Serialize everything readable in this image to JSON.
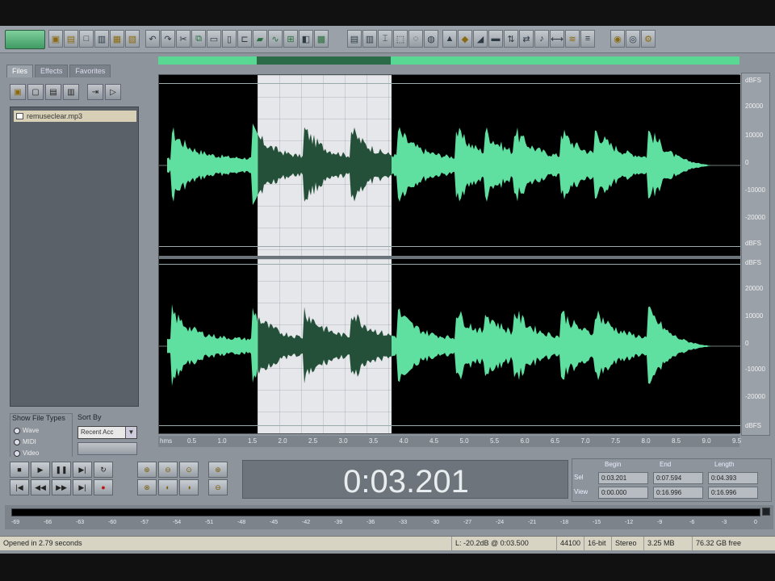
{
  "window": {
    "file_tabs": [
      "Files",
      "Effects",
      "Favorites"
    ]
  },
  "file_panel": {
    "files": [
      "remuseclear.mp3"
    ],
    "show_file_types_label": "Show File Types",
    "file_types": [
      "Wave",
      "MIDI",
      "Video"
    ],
    "sort_by_label": "Sort By",
    "sort_by_value": "Recent Acc",
    "sort_button_1": "",
    "sort_button_2": ""
  },
  "editor": {
    "db_scale_top": [
      "dBFS",
      "20000",
      "10000",
      "0",
      "-10000",
      "-20000",
      "dBFS"
    ],
    "db_scale_bottom": [
      "dBFS",
      "20000",
      "10000",
      "0",
      "-10000",
      "-20000",
      "dBFS"
    ],
    "timeline_unit": "hms",
    "timeline_ticks": [
      "0.5",
      "1.0",
      "1.5",
      "2.0",
      "2.5",
      "3.0",
      "3.5",
      "4.0",
      "4.5",
      "5.0",
      "5.5",
      "6.0",
      "6.5",
      "7.0",
      "7.5",
      "8.0",
      "8.5",
      "9.0",
      "9.5"
    ],
    "selection_fraction": [
      0.17,
      0.4
    ]
  },
  "time_display": {
    "time": "0:03.201"
  },
  "selection_view": {
    "headers": [
      "Begin",
      "End",
      "Length"
    ],
    "rows": [
      {
        "label": "Sel",
        "begin": "0:03.201",
        "end": "0:07.594",
        "length": "0:04.393"
      },
      {
        "label": "View",
        "begin": "0:00.000",
        "end": "0:16.996",
        "length": "0:16.996"
      }
    ]
  },
  "level_meter": {
    "ticks": [
      "-69",
      "-66",
      "-63",
      "-60",
      "-57",
      "-54",
      "-51",
      "-48",
      "-45",
      "-42",
      "-39",
      "-36",
      "-33",
      "-30",
      "-27",
      "-24",
      "-21",
      "-18",
      "-15",
      "-12",
      "-9",
      "-6",
      "-3",
      "0"
    ]
  },
  "status_bar": {
    "message": "Opened in 2.79 seconds",
    "level_info": "L: -20.2dB @ 0:03.500",
    "format_rate": "44100",
    "format_bits": "16-bit",
    "format_channels": "Stereo",
    "file_size": "3.25 MB",
    "free_space": "76.32 GB free"
  }
}
